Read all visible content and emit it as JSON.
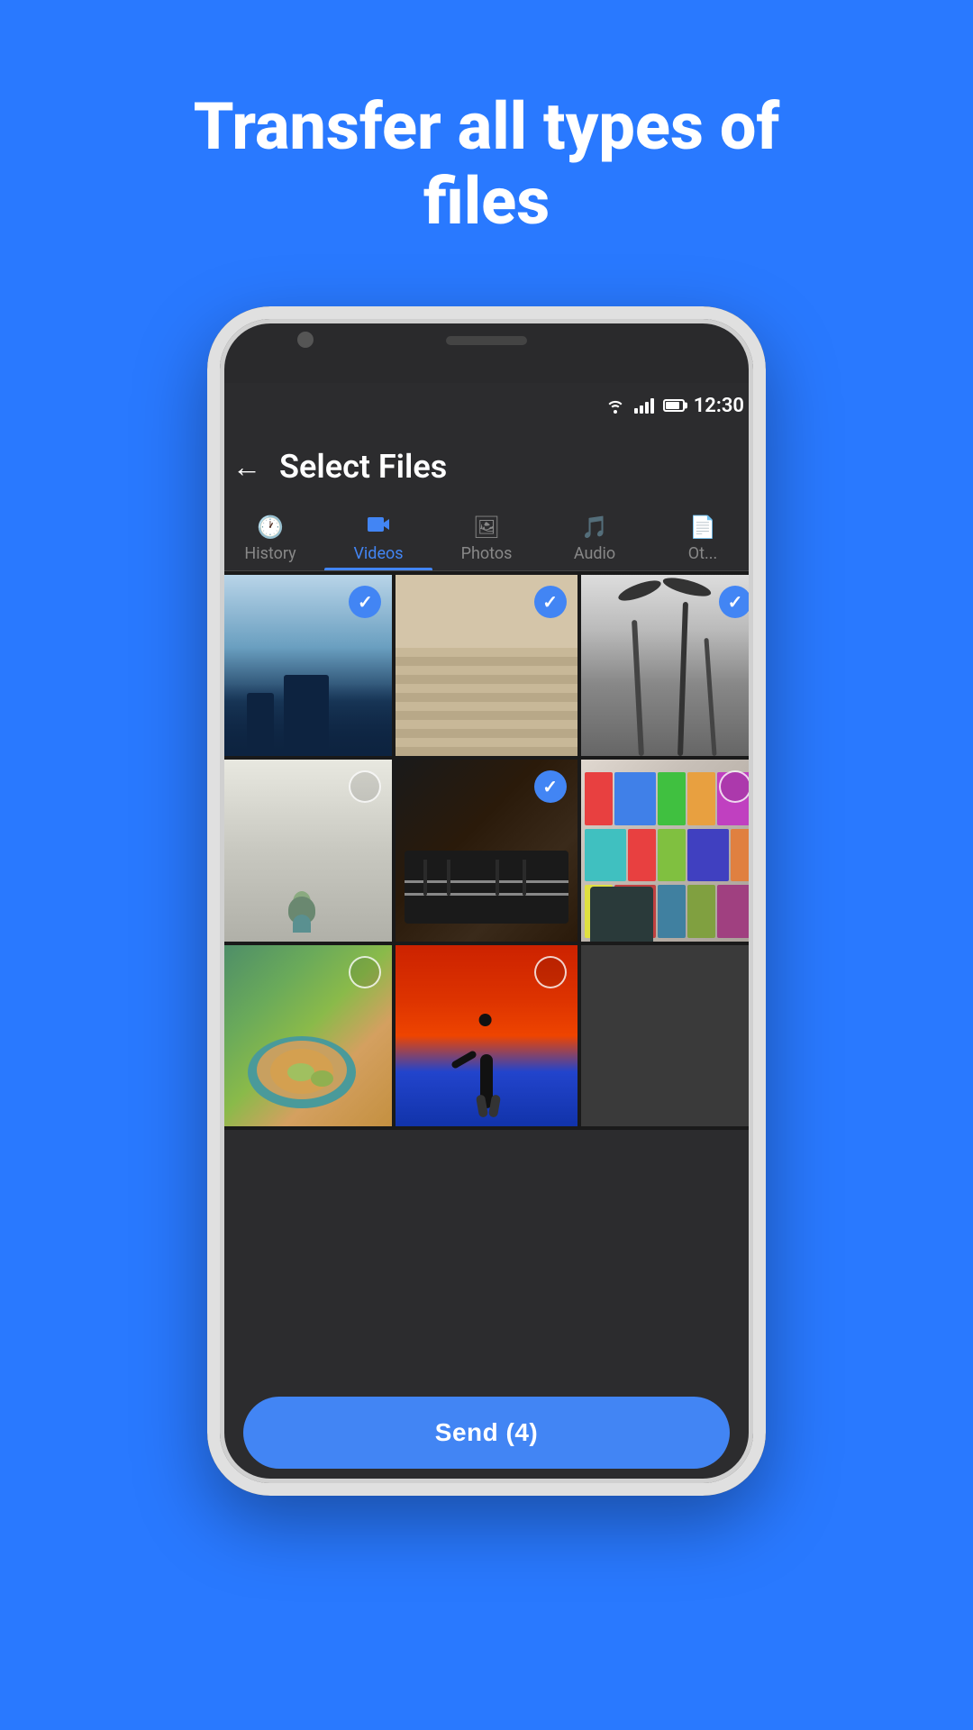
{
  "headline": {
    "line1": "Transfer all types of",
    "line2": "files"
  },
  "phone": {
    "status_bar": {
      "time": "12:30"
    },
    "app_bar": {
      "back_label": "←",
      "title": "Select Files"
    },
    "tabs": [
      {
        "id": "history",
        "label": "History",
        "icon": "🕐",
        "active": false
      },
      {
        "id": "videos",
        "label": "Videos",
        "icon": "📹",
        "active": true
      },
      {
        "id": "photos",
        "label": "Photos",
        "icon": "🖼",
        "active": false
      },
      {
        "id": "audio",
        "label": "Audio",
        "icon": "🎵",
        "active": false
      },
      {
        "id": "other",
        "label": "Ot...",
        "icon": "📄",
        "active": false
      }
    ],
    "grid": [
      {
        "id": "cell-1",
        "type": "sky",
        "selected": true
      },
      {
        "id": "cell-2",
        "type": "stairs",
        "selected": true
      },
      {
        "id": "cell-3",
        "type": "palms",
        "selected": true
      },
      {
        "id": "cell-4",
        "type": "plant",
        "selected": false
      },
      {
        "id": "cell-5",
        "type": "piano",
        "selected": true
      },
      {
        "id": "cell-6",
        "type": "bookshelf",
        "selected": false
      },
      {
        "id": "cell-7",
        "type": "food",
        "selected": false
      },
      {
        "id": "cell-8",
        "type": "dancer",
        "selected": false
      }
    ],
    "send_button": {
      "label": "Send (4)"
    }
  },
  "colors": {
    "background": "#2979FF",
    "phone_bg": "#2c2c2e",
    "accent": "#4285F4",
    "text_white": "#ffffff",
    "tab_active": "#4285F4",
    "tab_inactive": "#888888"
  }
}
